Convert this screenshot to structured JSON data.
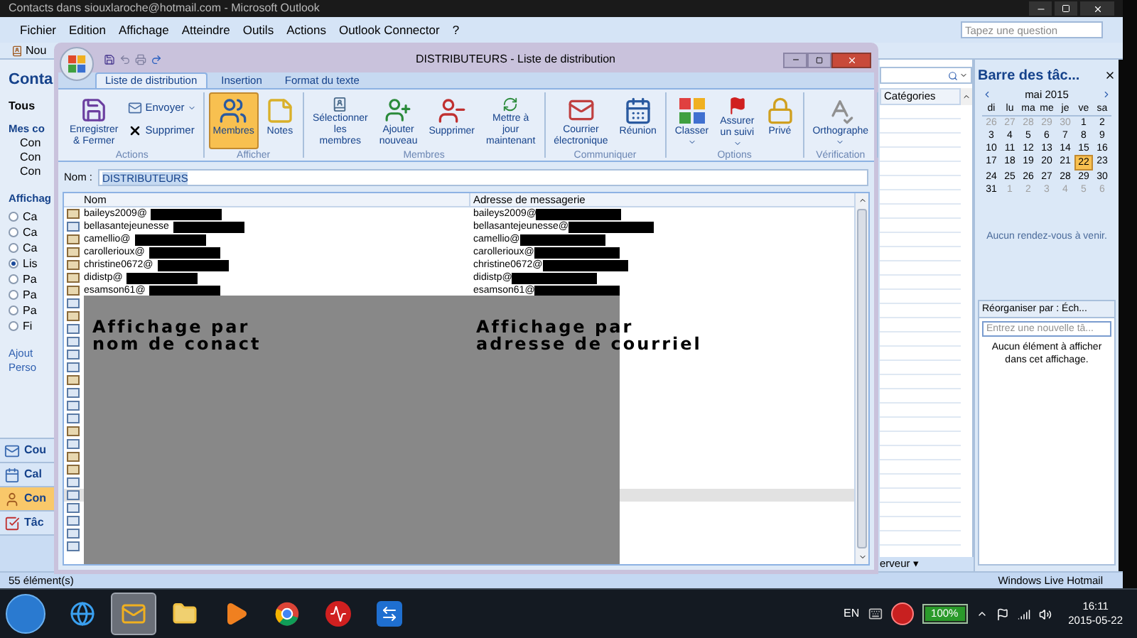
{
  "window": {
    "title": "Contacts dans siouxlaroche@hotmail.com - Microsoft Outlook"
  },
  "menu": [
    "Fichier",
    "Edition",
    "Affichage",
    "Atteindre",
    "Outils",
    "Actions",
    "Outlook Connector",
    "?"
  ],
  "help_search": {
    "placeholder": "Tapez une question"
  },
  "toolbar": {
    "new_button": "Nou"
  },
  "navigation_pane": {
    "title": "Conta",
    "all_folders": "Tous",
    "my_contacts": "Mes co",
    "folders": [
      "Con",
      "Con",
      "Con"
    ],
    "view_heading": "Affichag",
    "views": [
      {
        "label": "Ca",
        "selected": false
      },
      {
        "label": "Ca",
        "selected": false
      },
      {
        "label": "Ca",
        "selected": false
      },
      {
        "label": "Lis",
        "selected": true
      },
      {
        "label": "Pa",
        "selected": false
      },
      {
        "label": "Pa",
        "selected": false
      },
      {
        "label": "Pa",
        "selected": false
      },
      {
        "label": "Fi",
        "selected": false
      }
    ],
    "links": [
      "Ajout",
      "Perso"
    ],
    "buttons": [
      {
        "kind": "mail",
        "label": "Cou",
        "selected": false
      },
      {
        "kind": "calendar",
        "label": "Cal",
        "selected": false
      },
      {
        "kind": "contacts",
        "label": "Con",
        "selected": true
      },
      {
        "kind": "tasks",
        "label": "Tâc",
        "selected": false
      }
    ]
  },
  "contact_list": {
    "columns": [
      "Catégories"
    ],
    "footer": "erveur ▾"
  },
  "todo_bar": {
    "title": "Barre des tâc...",
    "calendar": {
      "month": "mai 2015",
      "weekdays": [
        "di",
        "lu",
        "ma",
        "me",
        "je",
        "ve",
        "sa"
      ],
      "days": [
        {
          "n": "26",
          "muted": true,
          "selected": false
        },
        {
          "n": "27",
          "muted": true,
          "selected": false
        },
        {
          "n": "28",
          "muted": true,
          "selected": false
        },
        {
          "n": "29",
          "muted": true,
          "selected": false
        },
        {
          "n": "30",
          "muted": true,
          "selected": false
        },
        {
          "n": "1",
          "muted": false,
          "selected": false
        },
        {
          "n": "2",
          "muted": false,
          "selected": false
        },
        {
          "n": "3",
          "muted": false,
          "selected": false
        },
        {
          "n": "4",
          "muted": false,
          "selected": false
        },
        {
          "n": "5",
          "muted": false,
          "selected": false
        },
        {
          "n": "6",
          "muted": false,
          "selected": false
        },
        {
          "n": "7",
          "muted": false,
          "selected": false
        },
        {
          "n": "8",
          "muted": false,
          "selected": false
        },
        {
          "n": "9",
          "muted": false,
          "selected": false
        },
        {
          "n": "10",
          "muted": false,
          "selected": false
        },
        {
          "n": "11",
          "muted": false,
          "selected": false
        },
        {
          "n": "12",
          "muted": false,
          "selected": false
        },
        {
          "n": "13",
          "muted": false,
          "selected": false
        },
        {
          "n": "14",
          "muted": false,
          "selected": false
        },
        {
          "n": "15",
          "muted": false,
          "selected": false
        },
        {
          "n": "16",
          "muted": false,
          "selected": false
        },
        {
          "n": "17",
          "muted": false,
          "selected": false
        },
        {
          "n": "18",
          "muted": false,
          "selected": false
        },
        {
          "n": "19",
          "muted": false,
          "selected": false
        },
        {
          "n": "20",
          "muted": false,
          "selected": false
        },
        {
          "n": "21",
          "muted": false,
          "selected": false
        },
        {
          "n": "22",
          "muted": false,
          "selected": true
        },
        {
          "n": "23",
          "muted": false,
          "selected": false
        },
        {
          "n": "24",
          "muted": false,
          "selected": false
        },
        {
          "n": "25",
          "muted": false,
          "selected": false
        },
        {
          "n": "26",
          "muted": false,
          "selected": false
        },
        {
          "n": "27",
          "muted": false,
          "selected": false
        },
        {
          "n": "28",
          "muted": false,
          "selected": false
        },
        {
          "n": "29",
          "muted": false,
          "selected": false
        },
        {
          "n": "30",
          "muted": false,
          "selected": false
        },
        {
          "n": "31",
          "muted": false,
          "selected": false
        },
        {
          "n": "1",
          "muted": true,
          "selected": false
        },
        {
          "n": "2",
          "muted": true,
          "selected": false
        },
        {
          "n": "3",
          "muted": true,
          "selected": false
        },
        {
          "n": "4",
          "muted": true,
          "selected": false
        },
        {
          "n": "5",
          "muted": true,
          "selected": false
        },
        {
          "n": "6",
          "muted": true,
          "selected": false
        }
      ]
    },
    "appointments_note": "Aucun rendez-vous à venir.",
    "tasks": {
      "arrange_by": "Réorganiser par : Éch...",
      "new_task": {
        "placeholder": "Entrez une nouvelle tâ..."
      },
      "empty_note": "Aucun élément à afficher\ndans cet affichage."
    }
  },
  "status_bar": {
    "count": "55 élément(s)",
    "hotmail": "Windows Live Hotmail"
  },
  "dialog": {
    "title": "DISTRIBUTEURS - Liste de distribution",
    "tabs": [
      {
        "label": "Liste de distribution",
        "selected": true
      },
      {
        "label": "Insertion",
        "selected": false
      },
      {
        "label": "Format du texte",
        "selected": false
      }
    ],
    "ribbon_groups": [
      {
        "label": "Actions",
        "buttons": [
          {
            "kind": "save",
            "label": "Enregistrer\n& Fermer"
          }
        ],
        "small_buttons": [
          {
            "kind": "send",
            "label": "Envoyer",
            "dropdown": true
          },
          {
            "kind": "delete",
            "label": "Supprimer"
          }
        ]
      },
      {
        "label": "Afficher",
        "buttons": [
          {
            "kind": "members",
            "label": "Membres",
            "selected": true
          },
          {
            "kind": "notes",
            "label": "Notes",
            "selected": false
          }
        ]
      },
      {
        "label": "Membres",
        "buttons": [
          {
            "kind": "select_members",
            "label": "Sélectionner\nles membres"
          },
          {
            "kind": "add_new",
            "label": "Ajouter\nnouveau"
          },
          {
            "kind": "remove",
            "label": "Supprimer"
          },
          {
            "kind": "update",
            "label": "Mettre à jour\nmaintenant"
          }
        ]
      },
      {
        "label": "Communiquer",
        "buttons": [
          {
            "kind": "email",
            "label": "Courrier\nélectronique"
          },
          {
            "kind": "meeting",
            "label": "Réunion"
          }
        ]
      },
      {
        "label": "Options",
        "buttons": [
          {
            "kind": "categorize",
            "label": "Classer",
            "dropdown": true
          },
          {
            "kind": "follow_up",
            "label": "Assurer\nun suivi",
            "dropdown": true
          },
          {
            "kind": "private",
            "label": "Privé"
          }
        ]
      },
      {
        "label": "Vérification",
        "buttons": [
          {
            "kind": "spelling",
            "label": "Orthographe",
            "dropdown": true
          }
        ]
      }
    ],
    "name_field": {
      "label": "Nom :",
      "value": "DISTRIBUTEURS"
    },
    "columns": [
      "Nom",
      "Adresse de messagerie"
    ],
    "members": [
      {
        "kind": "contact",
        "name": "baileys2009@",
        "address": "baileys2009@",
        "redacted": true,
        "selected": false
      },
      {
        "kind": "group",
        "name": "bellasantejeunesse",
        "address": "bellasantejeunesse@",
        "redacted": true,
        "selected": false
      },
      {
        "kind": "contact",
        "name": "camellio@",
        "address": "camellio@",
        "redacted": true,
        "selected": false
      },
      {
        "kind": "contact",
        "name": "carollerioux@",
        "address": "carollerioux@",
        "redacted": true,
        "selected": false
      },
      {
        "kind": "contact",
        "name": "christine0672@",
        "address": "christine0672@",
        "redacted": true,
        "selected": false
      },
      {
        "kind": "contact",
        "name": "didistp@",
        "address": "didistp@",
        "redacted": true,
        "selected": false
      },
      {
        "kind": "contact",
        "name": "esamson61@",
        "address": "esamson61@",
        "redacted": true,
        "selected": false
      },
      {
        "kind": "group",
        "selected": false
      },
      {
        "kind": "contact",
        "selected": false
      },
      {
        "kind": "group",
        "selected": false
      },
      {
        "kind": "group",
        "selected": false
      },
      {
        "kind": "group",
        "selected": false
      },
      {
        "kind": "group",
        "selected": false
      },
      {
        "kind": "contact",
        "selected": false
      },
      {
        "kind": "group",
        "selected": false
      },
      {
        "kind": "group",
        "selected": false
      },
      {
        "kind": "group",
        "selected": false
      },
      {
        "kind": "contact",
        "selected": false
      },
      {
        "kind": "group",
        "selected": false
      },
      {
        "kind": "contact",
        "selected": false
      },
      {
        "kind": "contact",
        "selected": false
      },
      {
        "kind": "group",
        "selected": false
      },
      {
        "kind": "group",
        "selected": true
      },
      {
        "kind": "group",
        "selected": false
      },
      {
        "kind": "group",
        "selected": false
      },
      {
        "kind": "group",
        "selected": false
      },
      {
        "kind": "group",
        "selected": false
      }
    ],
    "annotations": [
      "Affichage par\nnom de conact",
      "Affichage par\nadresse de courriel"
    ]
  },
  "taskbar": {
    "apps": [
      {
        "kind": "browser",
        "selected": false
      },
      {
        "kind": "mail",
        "selected": true
      },
      {
        "kind": "folder",
        "selected": false
      },
      {
        "kind": "player",
        "selected": false
      },
      {
        "kind": "chrome",
        "selected": false
      },
      {
        "kind": "pulse",
        "selected": false
      },
      {
        "kind": "remote",
        "selected": false
      }
    ],
    "language": "EN",
    "battery": {
      "label": "100%",
      "level": 1
    },
    "time": "16:11",
    "date": "2015-05-22"
  }
}
